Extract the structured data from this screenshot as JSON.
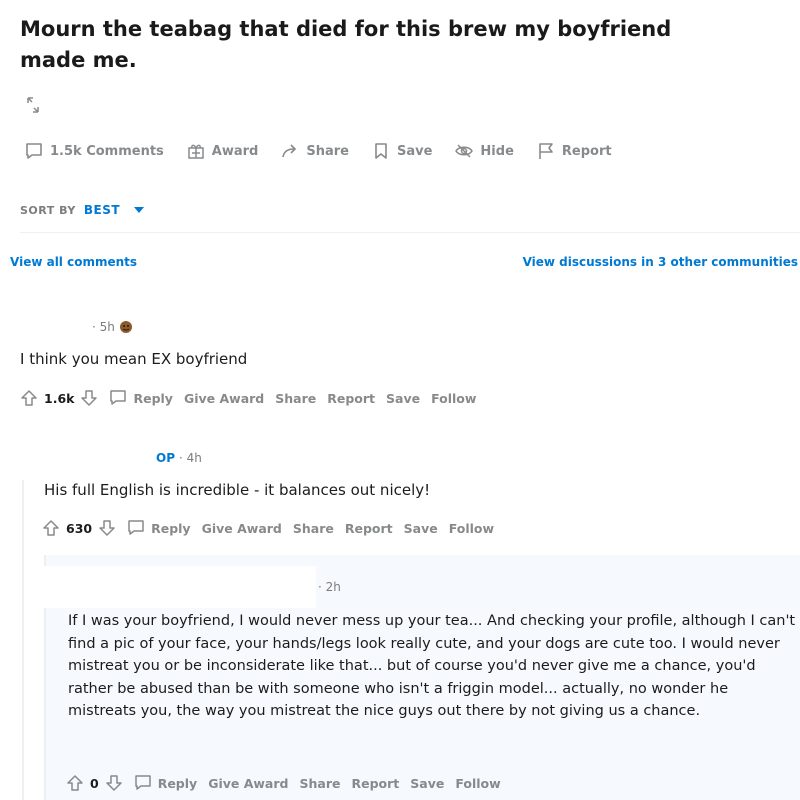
{
  "post": {
    "title": "Mourn the teabag that died for this brew my boyfriend made me.",
    "actions": {
      "comments": "1.5k Comments",
      "award": "Award",
      "share": "Share",
      "save": "Save",
      "hide": "Hide",
      "report": "Report"
    }
  },
  "sort": {
    "label": "SORT BY",
    "value": "BEST"
  },
  "links": {
    "view_all": "View all comments",
    "view_other": "View discussions in 3 other communities"
  },
  "comments": [
    {
      "meta": "· 5h",
      "text": "I think you mean EX boyfriend",
      "score": "1.6k",
      "actions": {
        "reply": "Reply",
        "give_award": "Give Award",
        "share": "Share",
        "report": "Report",
        "save": "Save",
        "follow": "Follow"
      }
    },
    {
      "op": "OP",
      "meta": "· 4h",
      "text": "His full English is incredible - it balances out nicely!",
      "score": "630",
      "actions": {
        "reply": "Reply",
        "give_award": "Give Award",
        "share": "Share",
        "report": "Report",
        "save": "Save",
        "follow": "Follow"
      }
    },
    {
      "meta": "· 2h",
      "text": "If I was your boyfriend, I would never mess up your tea... And checking your profile, although I can't find a pic of your face, your hands/legs look really cute, and your dogs are cute too. I would never mistreat you or be inconsiderate like that... but of course you'd never give me a chance, you'd rather be abused than be with someone who isn't a friggin model... actually, no wonder he mistreats you, the way you mistreat the nice guys out there by not giving us a chance.",
      "score": "0",
      "actions": {
        "reply": "Reply",
        "give_award": "Give Award",
        "share": "Share",
        "report": "Report",
        "save": "Save",
        "follow": "Follow"
      }
    }
  ],
  "colors": {
    "link": "#0079d3",
    "muted": "#878a8c",
    "text": "#1c1c1c"
  }
}
